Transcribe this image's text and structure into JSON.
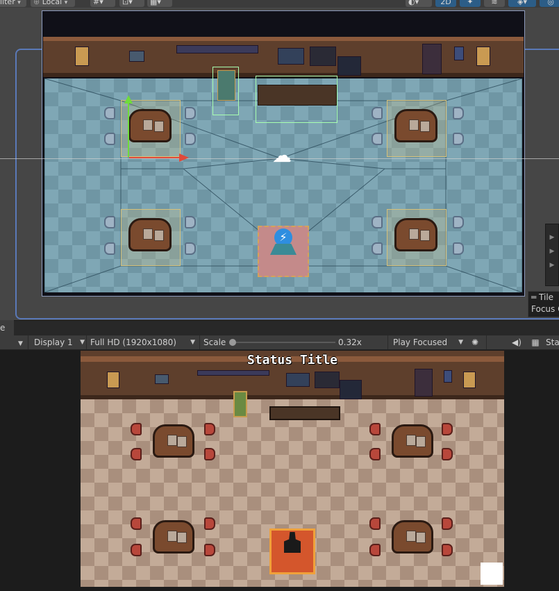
{
  "toolbar": {
    "filter_label": "ilter",
    "pivot_label": "Local",
    "mode_2d_label": "2D"
  },
  "scene": {
    "overlay_title": "Tile",
    "overlay_focus": "Focus C"
  },
  "game_tab": {
    "label": "e"
  },
  "game_toolbar": {
    "display_label": "Display 1",
    "resolution_label": "Full HD (1920x1080)",
    "scale_label": "Scale",
    "scale_value": "0.32x",
    "scale_fraction": 0.0,
    "play_mode_label": "Play Focused",
    "stats_label": "Sta"
  },
  "game": {
    "status_title": "Status Title"
  },
  "colors": {
    "accent_blue": "#2c5d87",
    "camera_outline": "#5a79b8",
    "floor_blue": "#7fa7b5",
    "floor_tan": "#c3ab98",
    "wall_brown": "#5e3f2c",
    "rug_orange": "#d4562c"
  },
  "icons": [
    "chevron-down-icon",
    "refresh-icon",
    "light-icon",
    "audio-off-icon",
    "layers-icon",
    "gizmos-icon",
    "bug-icon",
    "speaker-icon",
    "grid-icon",
    "lightning-icon",
    "flower-pot-icon"
  ]
}
